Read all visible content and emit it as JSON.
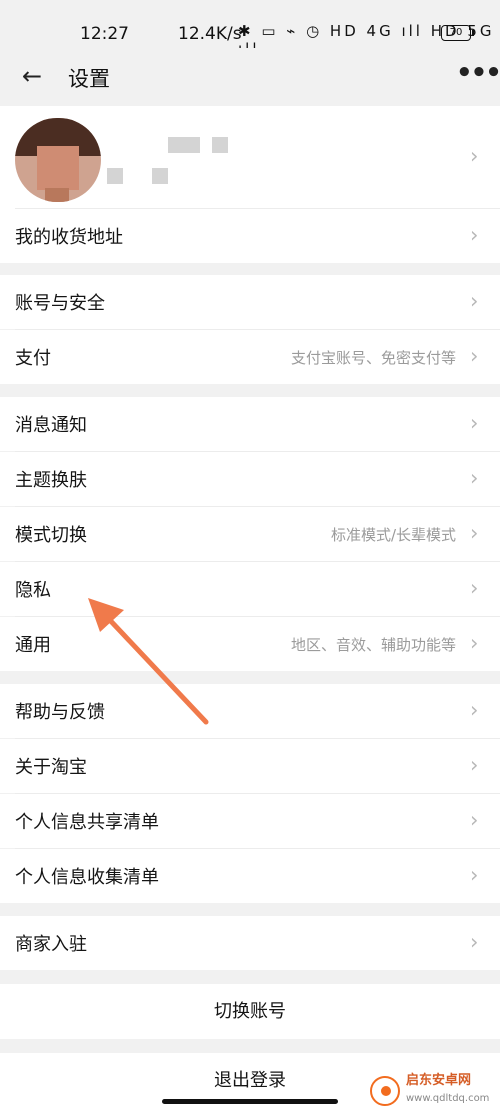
{
  "status_bar": {
    "time": "12:27",
    "speed": "12.4K/s",
    "icons": "✱ ▭ ⌁ ◷ HD 4G ıll HD 5G ıll",
    "battery": "70"
  },
  "nav": {
    "title": "设置",
    "back_icon": "←",
    "more_icon": "•••"
  },
  "rows": {
    "address": "我的收货地址",
    "account_security": "账号与安全",
    "payment": "支付",
    "payment_sub": "支付宝账号、免密支付等",
    "notifications": "消息通知",
    "theme": "主题换肤",
    "mode_switch": "模式切换",
    "mode_switch_sub": "标准模式/长辈模式",
    "privacy": "隐私",
    "general": "通用",
    "general_sub": "地区、音效、辅助功能等",
    "help": "帮助与反馈",
    "about": "关于淘宝",
    "info_share": "个人信息共享清单",
    "info_collect": "个人信息收集清单",
    "merchant": "商家入驻"
  },
  "actions": {
    "switch_account": "切换账号",
    "logout": "退出登录"
  },
  "chevron": "›",
  "watermark": {
    "name": "启东安卓网",
    "url": "www.qdltdq.com"
  },
  "colors": {
    "background": "#f1f1f1",
    "annotation_arrow": "#f07a4b"
  }
}
